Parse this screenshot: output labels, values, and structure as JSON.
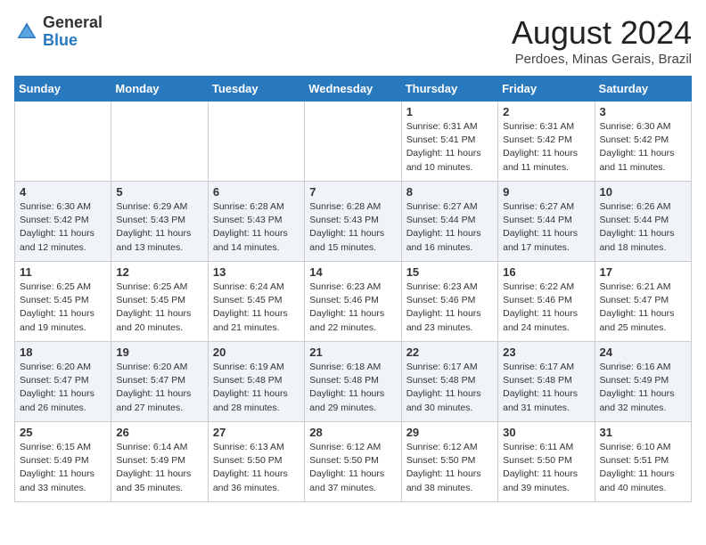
{
  "header": {
    "logo_line1": "General",
    "logo_line2": "Blue",
    "month": "August 2024",
    "location": "Perdoes, Minas Gerais, Brazil"
  },
  "days_of_week": [
    "Sunday",
    "Monday",
    "Tuesday",
    "Wednesday",
    "Thursday",
    "Friday",
    "Saturday"
  ],
  "weeks": [
    [
      {
        "date": "",
        "info": ""
      },
      {
        "date": "",
        "info": ""
      },
      {
        "date": "",
        "info": ""
      },
      {
        "date": "",
        "info": ""
      },
      {
        "date": "1",
        "info": "Sunrise: 6:31 AM\nSunset: 5:41 PM\nDaylight: 11 hours\nand 10 minutes."
      },
      {
        "date": "2",
        "info": "Sunrise: 6:31 AM\nSunset: 5:42 PM\nDaylight: 11 hours\nand 11 minutes."
      },
      {
        "date": "3",
        "info": "Sunrise: 6:30 AM\nSunset: 5:42 PM\nDaylight: 11 hours\nand 11 minutes."
      }
    ],
    [
      {
        "date": "4",
        "info": "Sunrise: 6:30 AM\nSunset: 5:42 PM\nDaylight: 11 hours\nand 12 minutes."
      },
      {
        "date": "5",
        "info": "Sunrise: 6:29 AM\nSunset: 5:43 PM\nDaylight: 11 hours\nand 13 minutes."
      },
      {
        "date": "6",
        "info": "Sunrise: 6:28 AM\nSunset: 5:43 PM\nDaylight: 11 hours\nand 14 minutes."
      },
      {
        "date": "7",
        "info": "Sunrise: 6:28 AM\nSunset: 5:43 PM\nDaylight: 11 hours\nand 15 minutes."
      },
      {
        "date": "8",
        "info": "Sunrise: 6:27 AM\nSunset: 5:44 PM\nDaylight: 11 hours\nand 16 minutes."
      },
      {
        "date": "9",
        "info": "Sunrise: 6:27 AM\nSunset: 5:44 PM\nDaylight: 11 hours\nand 17 minutes."
      },
      {
        "date": "10",
        "info": "Sunrise: 6:26 AM\nSunset: 5:44 PM\nDaylight: 11 hours\nand 18 minutes."
      }
    ],
    [
      {
        "date": "11",
        "info": "Sunrise: 6:25 AM\nSunset: 5:45 PM\nDaylight: 11 hours\nand 19 minutes."
      },
      {
        "date": "12",
        "info": "Sunrise: 6:25 AM\nSunset: 5:45 PM\nDaylight: 11 hours\nand 20 minutes."
      },
      {
        "date": "13",
        "info": "Sunrise: 6:24 AM\nSunset: 5:45 PM\nDaylight: 11 hours\nand 21 minutes."
      },
      {
        "date": "14",
        "info": "Sunrise: 6:23 AM\nSunset: 5:46 PM\nDaylight: 11 hours\nand 22 minutes."
      },
      {
        "date": "15",
        "info": "Sunrise: 6:23 AM\nSunset: 5:46 PM\nDaylight: 11 hours\nand 23 minutes."
      },
      {
        "date": "16",
        "info": "Sunrise: 6:22 AM\nSunset: 5:46 PM\nDaylight: 11 hours\nand 24 minutes."
      },
      {
        "date": "17",
        "info": "Sunrise: 6:21 AM\nSunset: 5:47 PM\nDaylight: 11 hours\nand 25 minutes."
      }
    ],
    [
      {
        "date": "18",
        "info": "Sunrise: 6:20 AM\nSunset: 5:47 PM\nDaylight: 11 hours\nand 26 minutes."
      },
      {
        "date": "19",
        "info": "Sunrise: 6:20 AM\nSunset: 5:47 PM\nDaylight: 11 hours\nand 27 minutes."
      },
      {
        "date": "20",
        "info": "Sunrise: 6:19 AM\nSunset: 5:48 PM\nDaylight: 11 hours\nand 28 minutes."
      },
      {
        "date": "21",
        "info": "Sunrise: 6:18 AM\nSunset: 5:48 PM\nDaylight: 11 hours\nand 29 minutes."
      },
      {
        "date": "22",
        "info": "Sunrise: 6:17 AM\nSunset: 5:48 PM\nDaylight: 11 hours\nand 30 minutes."
      },
      {
        "date": "23",
        "info": "Sunrise: 6:17 AM\nSunset: 5:48 PM\nDaylight: 11 hours\nand 31 minutes."
      },
      {
        "date": "24",
        "info": "Sunrise: 6:16 AM\nSunset: 5:49 PM\nDaylight: 11 hours\nand 32 minutes."
      }
    ],
    [
      {
        "date": "25",
        "info": "Sunrise: 6:15 AM\nSunset: 5:49 PM\nDaylight: 11 hours\nand 33 minutes."
      },
      {
        "date": "26",
        "info": "Sunrise: 6:14 AM\nSunset: 5:49 PM\nDaylight: 11 hours\nand 35 minutes."
      },
      {
        "date": "27",
        "info": "Sunrise: 6:13 AM\nSunset: 5:50 PM\nDaylight: 11 hours\nand 36 minutes."
      },
      {
        "date": "28",
        "info": "Sunrise: 6:12 AM\nSunset: 5:50 PM\nDaylight: 11 hours\nand 37 minutes."
      },
      {
        "date": "29",
        "info": "Sunrise: 6:12 AM\nSunset: 5:50 PM\nDaylight: 11 hours\nand 38 minutes."
      },
      {
        "date": "30",
        "info": "Sunrise: 6:11 AM\nSunset: 5:50 PM\nDaylight: 11 hours\nand 39 minutes."
      },
      {
        "date": "31",
        "info": "Sunrise: 6:10 AM\nSunset: 5:51 PM\nDaylight: 11 hours\nand 40 minutes."
      }
    ]
  ]
}
